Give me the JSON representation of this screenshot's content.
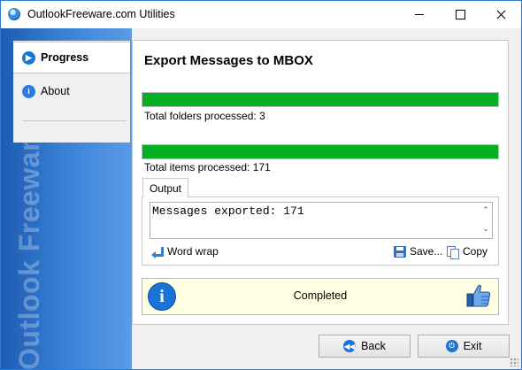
{
  "window": {
    "title": "OutlookFreeware.com Utilities",
    "controls": {
      "minimize": "minimize",
      "maximize": "maximize",
      "close": "close"
    }
  },
  "sidebar": {
    "watermark": "Outlook Freeware .com",
    "items": [
      {
        "label": "Progress",
        "icon": "play-icon",
        "active": true
      },
      {
        "label": "About",
        "icon": "info-icon",
        "active": false
      }
    ]
  },
  "main": {
    "heading": "Export Messages to MBOX",
    "progress": [
      {
        "label": "Total folders processed: 3",
        "value": 1.0
      },
      {
        "label": "Total items processed: 171",
        "value": 1.0
      }
    ],
    "output": {
      "tab_label": "Output",
      "text": "Messages exported: 171",
      "word_wrap_label": "Word wrap",
      "save_label": "Save...",
      "copy_label": "Copy"
    },
    "status": {
      "text": "Completed",
      "icon": "info-icon",
      "badge": "thumbs-up-icon",
      "background": "#ffffe4"
    }
  },
  "footer": {
    "back_label": "Back",
    "exit_label": "Exit"
  },
  "colors": {
    "accent": "#1a73d6",
    "progress_fill": "#06b025",
    "sidebar": "#3a82d8"
  }
}
